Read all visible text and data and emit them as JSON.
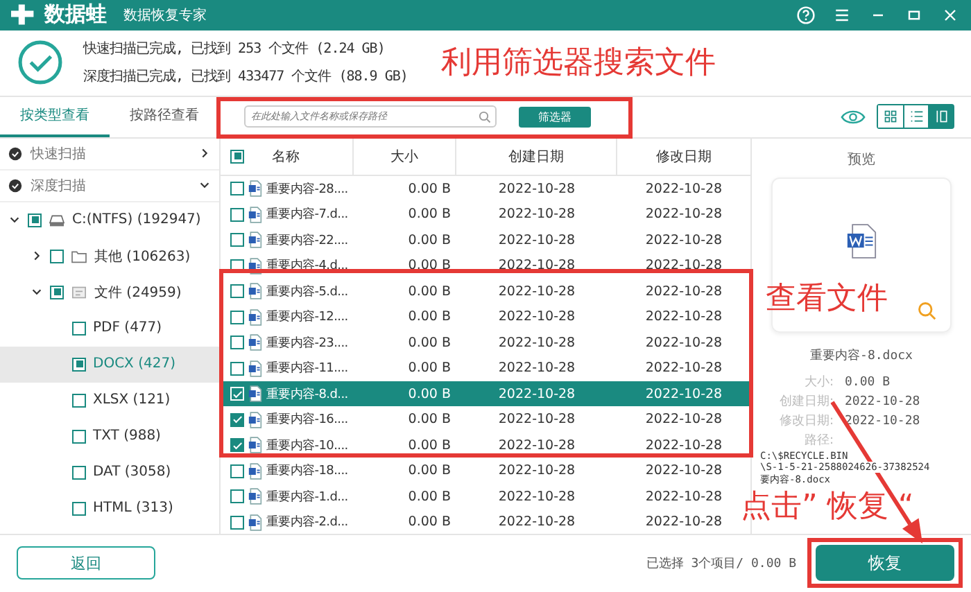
{
  "window": {
    "title": "数据蛙",
    "subtitle": "数据恢复专家"
  },
  "scan_status": [
    "快速扫描已完成, 已找到  253  个文件  (2.24 GB)",
    "深度扫描已完成, 已找到  433477  个文件  (88.9 GB)"
  ],
  "tabs": [
    {
      "label": "按类型查看",
      "selected": true
    },
    {
      "label": "按路径查看",
      "selected": false
    }
  ],
  "search": {
    "placeholder": "在此处输入文件名称或保存路径"
  },
  "filter_button": "筛选器",
  "view_modes": [
    {
      "kind": "grid",
      "selected": false
    },
    {
      "kind": "list",
      "selected": false
    },
    {
      "kind": "detail",
      "selected": true
    }
  ],
  "sidebar": {
    "scans": [
      {
        "label": "快速扫描",
        "expanded": false
      },
      {
        "label": "深度扫描",
        "expanded": true
      }
    ],
    "tree": [
      {
        "label": "C:(NTFS) (192947)",
        "kind": "drive",
        "partial": true,
        "expanded": true,
        "selected": false,
        "children": [
          {
            "label": "其他 (106263)",
            "kind": "folder",
            "partial": false,
            "expanded": false,
            "selected": false
          },
          {
            "label": "文件 (24959)",
            "kind": "files",
            "partial": true,
            "expanded": true,
            "selected": false,
            "children": [
              {
                "label": "PDF (477)",
                "partial": false,
                "selected": false
              },
              {
                "label": "DOCX (427)",
                "partial": true,
                "selected": true
              },
              {
                "label": "XLSX (121)",
                "partial": false,
                "selected": false
              },
              {
                "label": "TXT (988)",
                "partial": false,
                "selected": false
              },
              {
                "label": "DAT (3058)",
                "partial": false,
                "selected": false
              },
              {
                "label": "HTML (313)",
                "partial": false,
                "selected": false
              }
            ]
          }
        ]
      }
    ]
  },
  "table": {
    "columns": [
      "名称",
      "大小",
      "创建日期",
      "修改日期"
    ],
    "header_partial": true,
    "rows": [
      {
        "name": "重要内容-28....",
        "size": "0.00  B",
        "created": "2022-10-28",
        "modified": "2022-10-28",
        "checked": false,
        "selected": false
      },
      {
        "name": "重要内容-7.d...",
        "size": "0.00  B",
        "created": "2022-10-28",
        "modified": "2022-10-28",
        "checked": false,
        "selected": false
      },
      {
        "name": "重要内容-22....",
        "size": "0.00  B",
        "created": "2022-10-28",
        "modified": "2022-10-28",
        "checked": false,
        "selected": false
      },
      {
        "name": "重要内容-4.d...",
        "size": "0.00  B",
        "created": "2022-10-28",
        "modified": "2022-10-28",
        "checked": false,
        "selected": false
      },
      {
        "name": "重要内容-5.d...",
        "size": "0.00  B",
        "created": "2022-10-28",
        "modified": "2022-10-28",
        "checked": false,
        "selected": false
      },
      {
        "name": "重要内容-12....",
        "size": "0.00  B",
        "created": "2022-10-28",
        "modified": "2022-10-28",
        "checked": false,
        "selected": false
      },
      {
        "name": "重要内容-23....",
        "size": "0.00  B",
        "created": "2022-10-28",
        "modified": "2022-10-28",
        "checked": false,
        "selected": false
      },
      {
        "name": "重要内容-11....",
        "size": "0.00  B",
        "created": "2022-10-28",
        "modified": "2022-10-28",
        "checked": false,
        "selected": false
      },
      {
        "name": "重要内容-8.d...",
        "size": "0.00  B",
        "created": "2022-10-28",
        "modified": "2022-10-28",
        "checked": true,
        "selected": true
      },
      {
        "name": "重要内容-16....",
        "size": "0.00  B",
        "created": "2022-10-28",
        "modified": "2022-10-28",
        "checked": true,
        "selected": false
      },
      {
        "name": "重要内容-10....",
        "size": "0.00  B",
        "created": "2022-10-28",
        "modified": "2022-10-28",
        "checked": true,
        "selected": false
      },
      {
        "name": "重要内容-18....",
        "size": "0.00  B",
        "created": "2022-10-28",
        "modified": "2022-10-28",
        "checked": false,
        "selected": false
      },
      {
        "name": "重要内容-1.d...",
        "size": "0.00  B",
        "created": "2022-10-28",
        "modified": "2022-10-28",
        "checked": false,
        "selected": false
      },
      {
        "name": "重要内容-2.d...",
        "size": "0.00  B",
        "created": "2022-10-28",
        "modified": "2022-10-28",
        "checked": false,
        "selected": false
      }
    ]
  },
  "preview": {
    "title": "预览",
    "file_name": "重要内容-8.docx",
    "details": [
      {
        "label": "大小:",
        "value": "0.00  B"
      },
      {
        "label": "创建日期:",
        "value": "2022-10-28"
      },
      {
        "label": "修改日期:",
        "value": "2022-10-28"
      },
      {
        "label": "路径:"
      }
    ],
    "path_lines": [
      "C:\\$RECYCLE.BIN",
      "\\S-1-5-21-2588024626-37382524",
      "要内容-8.docx"
    ]
  },
  "footer": {
    "back_button": "返回",
    "selection": "已选择 3个项目/ 0.00 B",
    "recover_button": "恢复"
  },
  "annotations": {
    "search_note": "利用筛选器搜索文件",
    "view_note": "查看文件",
    "recover_note": "点击”  恢复  “"
  }
}
